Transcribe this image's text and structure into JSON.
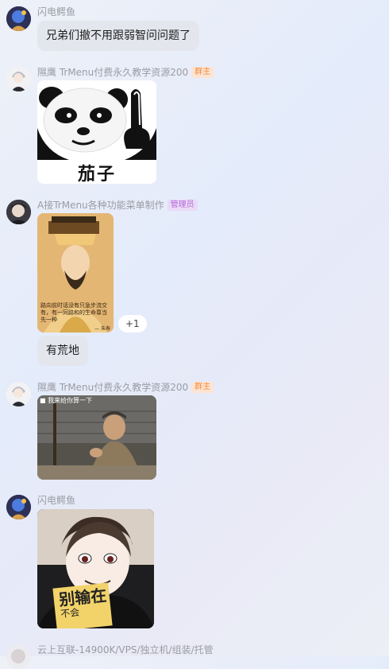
{
  "messages": [
    {
      "sender": "闪电鳄鱼",
      "text": "兄弟们撤不用跟弱智问问题了"
    },
    {
      "sender": "隰鹰 TrMenu付费永久教学资源200",
      "badge": "群主",
      "sticker_caption": "茄子"
    },
    {
      "sender": "A接TrMenu各种功能菜单制作",
      "badge": "管理员",
      "image_poem": "路向前时话没有只急步流交有，有一同路和的生命尊当先一种",
      "image_poem_sign": "— 朱寿",
      "reaction": "+1",
      "text": "有荒地"
    },
    {
      "sender": "隰鹰 TrMenu付费永久教学资源200",
      "badge": "群主",
      "video_caption": "我来给你算一下"
    },
    {
      "sender": "闪电鳄鱼",
      "book_title_1": "别输在",
      "book_title_2": "不会"
    },
    {
      "sender": "云上互联-14900K/VPS/独立机/组装/托管"
    }
  ]
}
